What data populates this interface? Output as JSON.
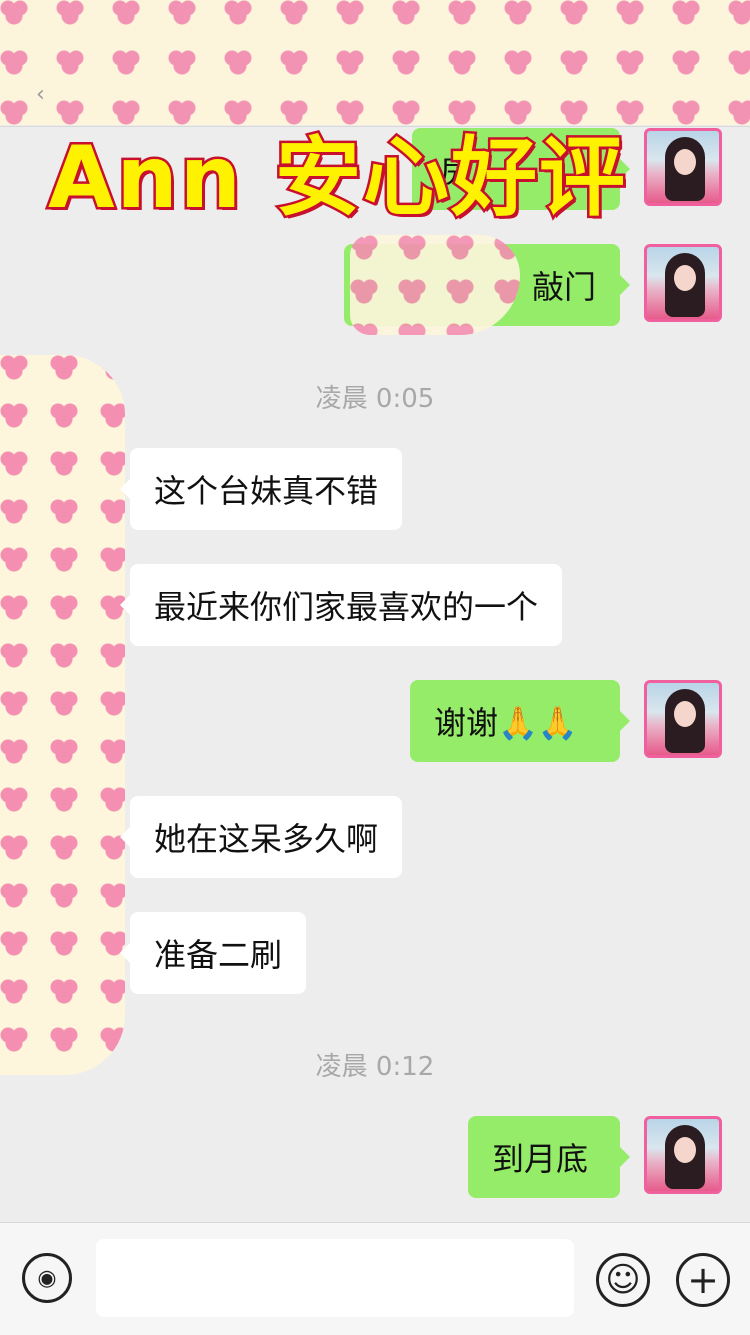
{
  "banner": {
    "text": "Ann 安心好评"
  },
  "header": {
    "back_glyph": "‹"
  },
  "messages": [
    {
      "id": "m1",
      "side": "out",
      "text": "房"
    },
    {
      "id": "m2",
      "side": "out",
      "text": "敲门"
    },
    {
      "id": "t1",
      "type": "time",
      "text": "凌晨 0:05"
    },
    {
      "id": "m3",
      "side": "in",
      "text": "这个台妹真不错"
    },
    {
      "id": "m4",
      "side": "in",
      "text": "最近来你们家最喜欢的一个"
    },
    {
      "id": "m5",
      "side": "out",
      "text": "谢谢🙏🙏"
    },
    {
      "id": "m6",
      "side": "in",
      "text": "她在这呆多久啊"
    },
    {
      "id": "m7",
      "side": "in",
      "text": "准备二刷"
    },
    {
      "id": "t2",
      "type": "time",
      "text": "凌晨 0:12"
    },
    {
      "id": "m8",
      "side": "out",
      "text": "到月底"
    }
  ],
  "input_bar": {
    "voice_icon": "voice-icon",
    "emoji_icon": "emoji-icon",
    "plus_icon": "plus-icon",
    "voice_glyph": "◉",
    "emoji_glyph": "☺",
    "plus_glyph": "+"
  },
  "colors": {
    "bubble_out": "#95ec69",
    "bubble_in": "#ffffff",
    "banner_fill": "#fff200",
    "banner_stroke": "#c8102e",
    "avatar_border": "#f0609e"
  }
}
